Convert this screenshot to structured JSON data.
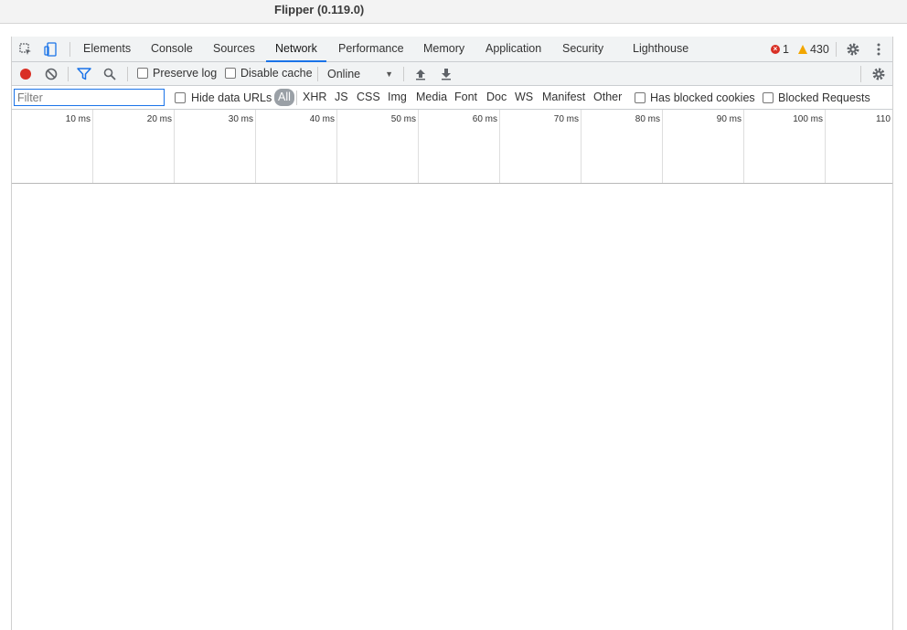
{
  "window": {
    "title": "Flipper (0.119.0)"
  },
  "tabs": [
    {
      "label": "Elements"
    },
    {
      "label": "Console"
    },
    {
      "label": "Sources"
    },
    {
      "label": "Network"
    },
    {
      "label": "Performance"
    },
    {
      "label": "Memory"
    },
    {
      "label": "Application"
    },
    {
      "label": "Security"
    },
    {
      "label": "Lighthouse"
    }
  ],
  "active_tab": "Network",
  "status": {
    "errors": "1",
    "warnings": "430"
  },
  "toolbar": {
    "preserve_log": "Preserve log",
    "disable_cache": "Disable cache",
    "throttling": "Online"
  },
  "filterbar": {
    "placeholder": "Filter",
    "hide_data_urls": "Hide data URLs",
    "types": [
      "All",
      "XHR",
      "JS",
      "CSS",
      "Img",
      "Media",
      "Font",
      "Doc",
      "WS",
      "Manifest",
      "Other"
    ],
    "has_blocked_cookies": "Has blocked cookies",
    "blocked_requests": "Blocked Requests"
  },
  "timeline": {
    "ticks": [
      "10 ms",
      "20 ms",
      "30 ms",
      "40 ms",
      "50 ms",
      "60 ms",
      "70 ms",
      "80 ms",
      "90 ms",
      "100 ms",
      "110"
    ]
  },
  "colors": {
    "accent": "#1a73e8",
    "record": "#d93025",
    "warning": "#f2a600"
  }
}
